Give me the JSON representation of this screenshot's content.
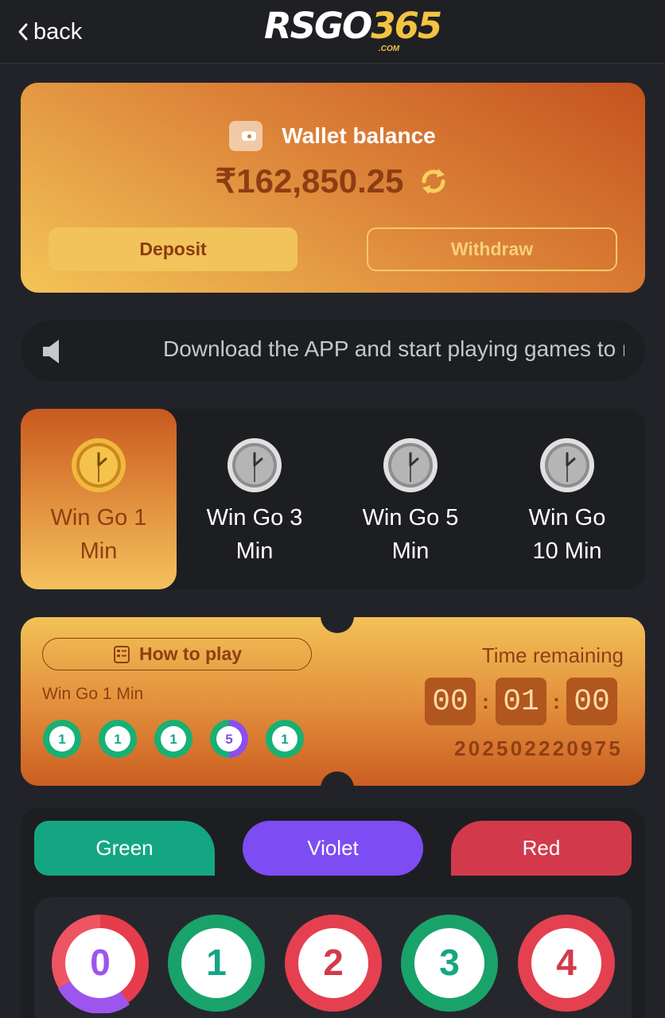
{
  "header": {
    "back_label": "back",
    "logo_main_a": "RSGO",
    "logo_main_b": "365",
    "logo_sub": ".COM"
  },
  "wallet": {
    "title": "Wallet balance",
    "balance": "₹162,850.25",
    "deposit_label": "Deposit",
    "withdraw_label": "Withdraw"
  },
  "notice": {
    "text": "Download the APP and start playing games to r"
  },
  "tabs": [
    {
      "line1": "Win Go 1",
      "line2": "Min",
      "active": true
    },
    {
      "line1": "Win Go 3",
      "line2": "Min",
      "active": false
    },
    {
      "line1": "Win Go 5",
      "line2": "Min",
      "active": false
    },
    {
      "line1": "Win Go",
      "line2": "10 Min",
      "active": false
    }
  ],
  "ticket": {
    "how_to_play": "How to play",
    "game_name": "Win Go 1 Min",
    "recent_results": [
      "1",
      "1",
      "1",
      "5",
      "1"
    ],
    "time_label": "Time remaining",
    "timer": [
      "00",
      "01",
      "00"
    ],
    "period": "202502220975"
  },
  "bet": {
    "green_label": "Green",
    "violet_label": "Violet",
    "red_label": "Red",
    "numbers": [
      "0",
      "1",
      "2",
      "3",
      "4"
    ]
  },
  "colors": {
    "green": "#14a683",
    "violet": "#7d4cf3",
    "red": "#d23a4c",
    "accent": "#f3c341"
  }
}
